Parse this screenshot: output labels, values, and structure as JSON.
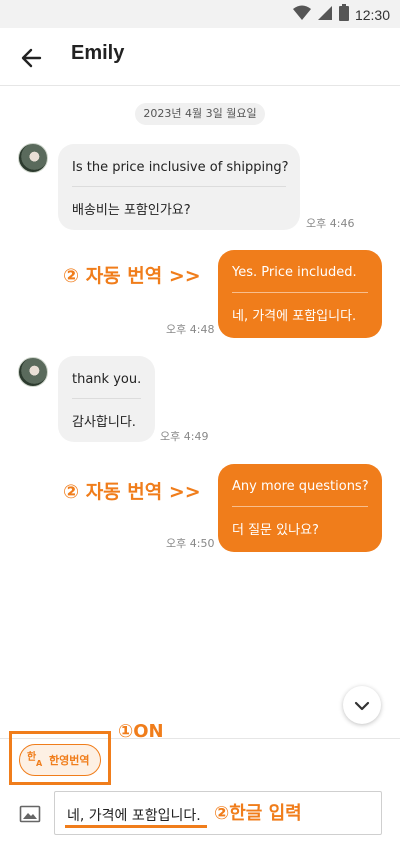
{
  "status_bar": {
    "time": "12:30"
  },
  "header": {
    "title": "Emily"
  },
  "date_separator": "2023년 4월 3일 월요일",
  "messages": [
    {
      "direction": "in",
      "original": "Is the price inclusive of shipping?",
      "translated": "배송비는 포함인가요?",
      "time": "오후 4:46"
    },
    {
      "direction": "out",
      "original": "Yes. Price included.",
      "translated": "네, 가격에 포함입니다.",
      "time": "오후 4:48"
    },
    {
      "direction": "in",
      "original": "thank you.",
      "translated": "감사합니다.",
      "time": "오후 4:49"
    },
    {
      "direction": "out",
      "original": "Any more questions?",
      "translated": "더 질문 있나요?",
      "time": "오후 4:50"
    }
  ],
  "annotations": {
    "auto_translate_1": "② 자동 번역 >>",
    "auto_translate_2": "② 자동 번역 >>",
    "toggle_on": "①ON",
    "korean_input": "②한글 입력"
  },
  "composer": {
    "translate_toggle_label": "한영번역",
    "input_value": "네, 가격에 포함입니다."
  },
  "colors": {
    "accent": "#f07d1b",
    "incoming_bubble": "#f1f1f1"
  },
  "icons": [
    "wifi-icon",
    "signal-icon",
    "battery-icon",
    "back-arrow-icon",
    "chevron-down-icon",
    "translate-icon",
    "image-icon"
  ]
}
